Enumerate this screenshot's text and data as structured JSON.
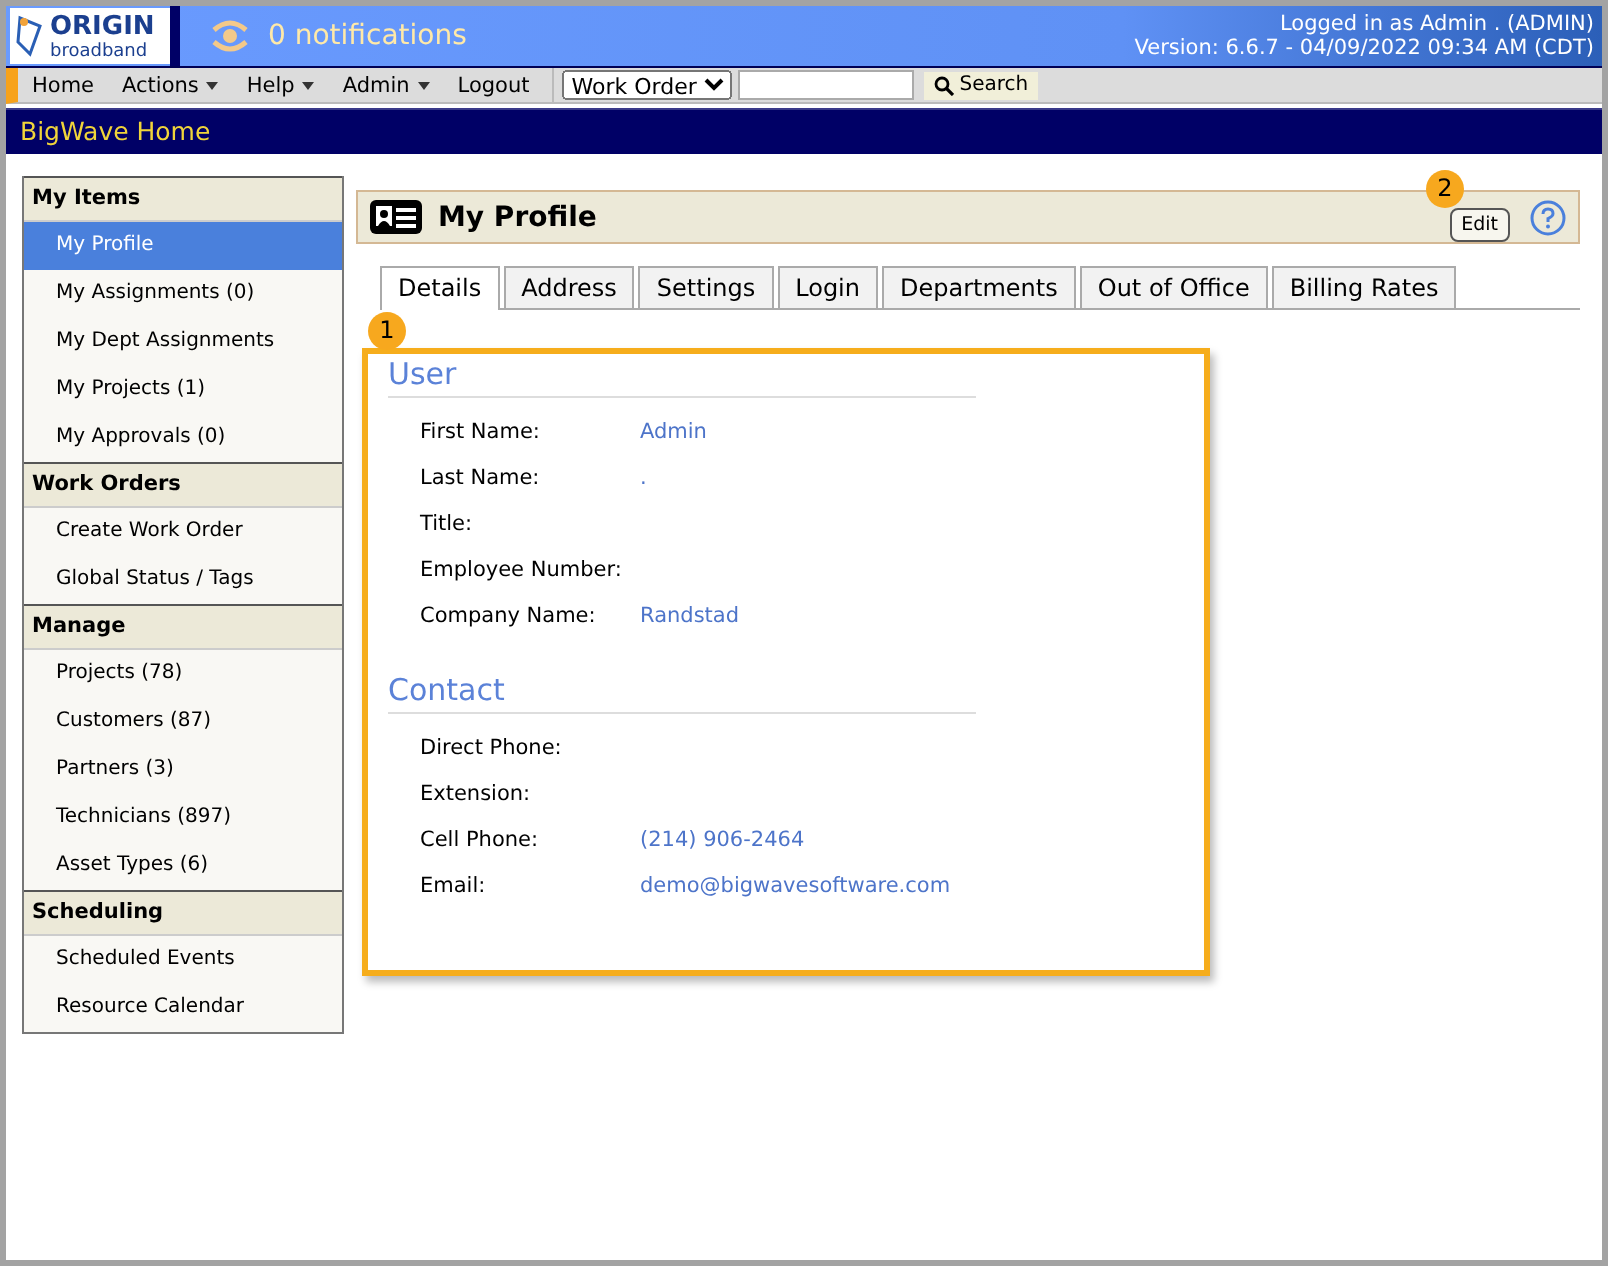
{
  "header": {
    "logo": {
      "top": "ORIGIN",
      "bottom": "broadband"
    },
    "notifications": "0 notifications",
    "login": "Logged in as Admin . (ADMIN)",
    "version": "Version: 6.6.7 - 04/09/2022 09:34 AM (CDT)"
  },
  "menu": {
    "items": [
      {
        "label": "Home",
        "dropdown": false
      },
      {
        "label": "Actions",
        "dropdown": true
      },
      {
        "label": "Help",
        "dropdown": true
      },
      {
        "label": "Admin",
        "dropdown": true
      },
      {
        "label": "Logout",
        "dropdown": false
      }
    ],
    "search_type": "Work Order",
    "search_button": "Search"
  },
  "banner": "BigWave Home",
  "sidebar": [
    {
      "title": "My Items",
      "items": [
        {
          "label": "My Profile",
          "selected": true
        },
        {
          "label": "My Assignments (0)",
          "selected": false
        },
        {
          "label": "My Dept Assignments",
          "selected": false
        },
        {
          "label": "My Projects (1)",
          "selected": false
        },
        {
          "label": "My Approvals (0)",
          "selected": false
        }
      ]
    },
    {
      "title": "Work Orders",
      "items": [
        {
          "label": "Create Work Order",
          "selected": false
        },
        {
          "label": "Global Status / Tags",
          "selected": false
        }
      ]
    },
    {
      "title": "Manage",
      "items": [
        {
          "label": "Projects (78)",
          "selected": false
        },
        {
          "label": "Customers (87)",
          "selected": false
        },
        {
          "label": "Partners (3)",
          "selected": false
        },
        {
          "label": "Technicians (897)",
          "selected": false
        },
        {
          "label": "Asset Types (6)",
          "selected": false
        }
      ]
    },
    {
      "title": "Scheduling",
      "items": [
        {
          "label": "Scheduled Events",
          "selected": false
        },
        {
          "label": "Resource Calendar",
          "selected": false
        }
      ]
    }
  ],
  "page": {
    "title": "My Profile",
    "edit_button": "Edit",
    "tabs": [
      {
        "label": "Details",
        "selected": true
      },
      {
        "label": "Address",
        "selected": false
      },
      {
        "label": "Settings",
        "selected": false
      },
      {
        "label": "Login",
        "selected": false
      },
      {
        "label": "Departments",
        "selected": false
      },
      {
        "label": "Out of Office",
        "selected": false
      },
      {
        "label": "Billing Rates",
        "selected": false
      }
    ],
    "sections": [
      {
        "title": "User",
        "fields": [
          {
            "label": "First Name:",
            "value": "Admin"
          },
          {
            "label": "Last Name:",
            "value": "."
          },
          {
            "label": "Title:"
          },
          {
            "label": "Employee Number:"
          },
          {
            "label": "Company Name:",
            "value": "Randstad"
          }
        ]
      },
      {
        "title": "Contact",
        "fields": [
          {
            "label": "Direct Phone:"
          },
          {
            "label": "Extension:"
          },
          {
            "label": "Cell Phone:",
            "value": "(214) 906-2464"
          },
          {
            "label": "Email:",
            "value": "demo@bigwavesoftware.com"
          }
        ]
      }
    ]
  },
  "annotations": [
    {
      "label": "1"
    },
    {
      "label": "2"
    }
  ]
}
